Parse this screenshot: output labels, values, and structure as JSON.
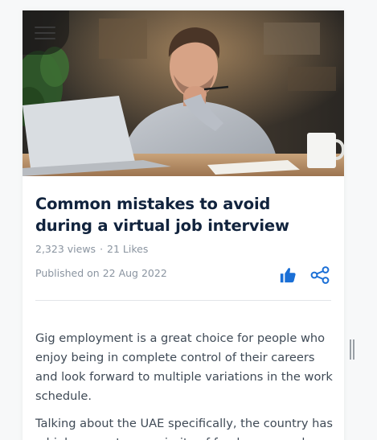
{
  "article": {
    "title": "Common mistakes to avoid during a virtual job interview",
    "views": "2,323 views",
    "separator": "·",
    "likes": "21 Likes",
    "published": "Published on 22 Aug 2022",
    "paragraphs": [
      "Gig employment is a great choice for people who enjoy being in complete control of their careers and look forward to multiple variations in the work schedule.",
      "Talking about the UAE specifically, the country has a high percentage majority of freelancers and"
    ]
  },
  "icons": {
    "menu": "hamburger-menu-icon",
    "like": "thumbs-up-icon",
    "share": "share-icon"
  },
  "colors": {
    "title": "#11233d",
    "meta": "#8a94a0",
    "body_text": "#3f4a56",
    "accent": "#1a6fd6",
    "divider": "#e2e5e8"
  }
}
